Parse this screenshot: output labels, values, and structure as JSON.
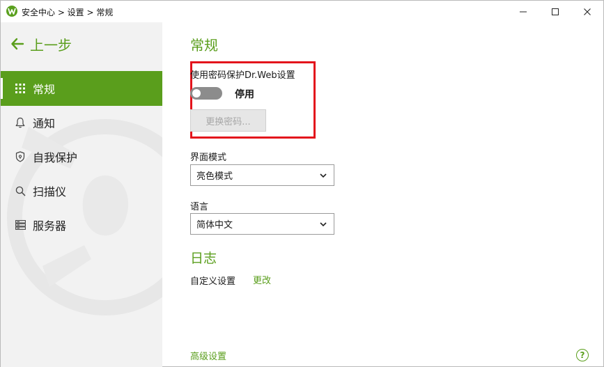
{
  "window": {
    "title": "安全中心 > 设置 > 常规",
    "controls": {
      "minimize": "—",
      "maximize": "☐",
      "close": "✕"
    }
  },
  "sidebar": {
    "back_label": "上一步",
    "items": [
      {
        "label": "常规",
        "icon": "grid-icon",
        "active": true
      },
      {
        "label": "通知",
        "icon": "bell-icon",
        "active": false
      },
      {
        "label": "自我保护",
        "icon": "shield-icon",
        "active": false
      },
      {
        "label": "扫描仪",
        "icon": "search-icon",
        "active": false
      },
      {
        "label": "服务器",
        "icon": "server-icon",
        "active": false
      }
    ]
  },
  "main": {
    "title": "常规",
    "password": {
      "label": "使用密码保护Dr.Web设置",
      "toggle_state": "停用",
      "toggle_on": false,
      "change_button": "更换密码..."
    },
    "ui_mode": {
      "label": "界面模式",
      "value": "亮色模式"
    },
    "language": {
      "label": "语言",
      "value": "简体中文"
    },
    "log": {
      "title": "日志",
      "setting_label": "自定义设置",
      "change_link": "更改"
    },
    "advanced_link": "高级设置",
    "help": "?"
  },
  "colors": {
    "accent": "#5a9e1c",
    "highlight": "#e3131c",
    "sidebar_bg": "#f2f2f2"
  }
}
